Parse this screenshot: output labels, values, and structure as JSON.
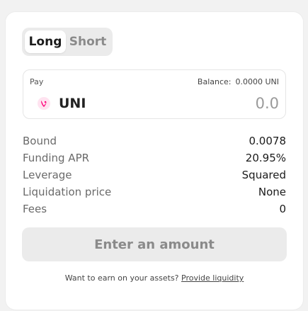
{
  "tabs": {
    "long": "Long",
    "short": "Short",
    "active": "Long"
  },
  "pay": {
    "label": "Pay",
    "balance_label": "Balance:",
    "balance_value": "0.0000 UNI",
    "token_symbol": "UNI",
    "token_icon": "uni-token-icon",
    "amount_placeholder": "0.0"
  },
  "stats": [
    {
      "label": "Bound",
      "value": "0.0078"
    },
    {
      "label": "Funding APR",
      "value": "20.95%"
    },
    {
      "label": "Leverage",
      "value": "Squared"
    },
    {
      "label": "Liquidation price",
      "value": "None"
    },
    {
      "label": "Fees",
      "value": "0"
    }
  ],
  "submit_label": "Enter an amount",
  "footer": {
    "text": "Want to earn on your assets?",
    "link": "Provide liquidity"
  },
  "colors": {
    "accent_pink": "#ff007a",
    "panel_bg": "#ebebeb"
  }
}
